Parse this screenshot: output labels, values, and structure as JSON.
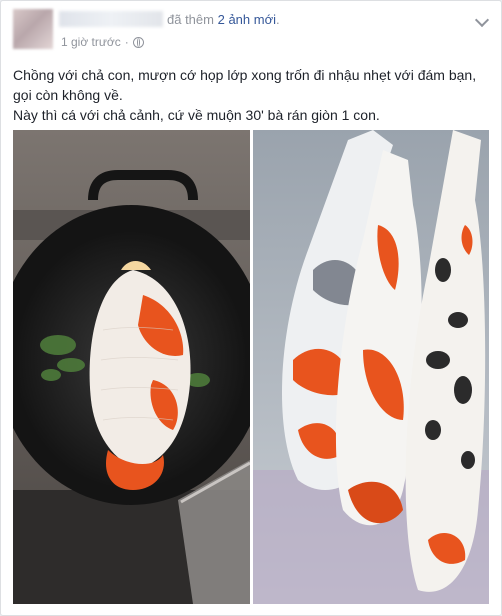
{
  "post": {
    "header_suffix": "đã thêm",
    "photo_count_link": "2 ảnh mới",
    "header_end": ".",
    "timestamp": "1 giờ trước",
    "separator": "·",
    "privacy_icon": "globe-icon",
    "menu_icon": "chevron-down-icon",
    "text_line_1": "Chồng với chả con, mượn cớ họp lớp xong trốn đi nhậu nhẹt với đám bạn,",
    "text_line_2": "gọi còn không về.",
    "text_line_3": "Này thì cá với chả cảnh, cứ về muộn 30' bà rán giòn 1 con."
  },
  "colors": {
    "link": "#365899",
    "meta": "#90949c",
    "text": "#1d2129",
    "koi_orange": "#e8541e"
  }
}
